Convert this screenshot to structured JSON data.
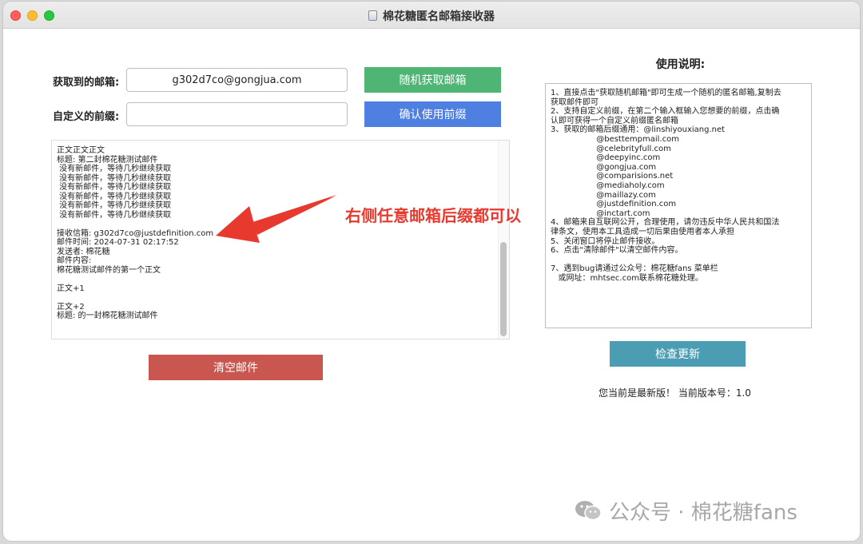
{
  "window": {
    "title": "棉花糖匿名邮箱接收器"
  },
  "email_row": {
    "label": "获取到的邮箱:",
    "value": "g302d7co@gongjua.com",
    "button": "随机获取邮箱"
  },
  "prefix_row": {
    "label": "自定义的前缀:",
    "value": "",
    "button": "确认使用前缀"
  },
  "log": {
    "lines": [
      "正文正文正文",
      "标题: 第二封棉花糖测试邮件",
      " 没有新邮件，等待几秒继续获取",
      " 没有新邮件，等待几秒继续获取",
      " 没有新邮件，等待几秒继续获取",
      " 没有新邮件，等待几秒继续获取",
      " 没有新邮件，等待几秒继续获取",
      " 没有新邮件，等待几秒继续获取",
      "",
      "接收信箱: g302d7co@justdefinition.com",
      "邮件时间: 2024-07-31 02:17:52",
      "发送者: 棉花糖",
      "邮件内容:",
      "棉花糖测试邮件的第一个正文",
      "",
      "正文+1",
      "",
      "正文+2",
      "标题: 的一封棉花糖测试邮件"
    ]
  },
  "annotation": "右侧任意邮箱后缀都可以",
  "clear_button": "清空邮件",
  "help": {
    "title": "使用说明:",
    "lines": [
      "1、直接点击\"获取随机邮箱\"即可生成一个随机的匿名邮箱,复制去",
      "获取邮件即可",
      "2、支持自定义前缀，在第二个输入框输入您想要的前缀，点击确",
      "认即可获得一个自定义前缀匿名邮箱",
      "3、获取的邮箱后缀通用：@linshiyouxiang.net",
      "                  @besttempmail.com",
      "                  @celebrityfull.com",
      "                  @deepyinc.com",
      "                  @gongjua.com",
      "                  @comparisions.net",
      "                  @mediaholy.com",
      "                  @maillazy.com",
      "                  @justdefinition.com",
      "                  @inctart.com",
      "4、邮箱来自互联网公开，合理使用，请勿违反中华人民共和国法",
      "律条文，使用本工具造成一切后果由使用者本人承担",
      "5、关闭窗口将停止邮件接收。",
      "6、点击\"清除邮件\"以清空邮件内容。",
      "",
      "7、遇到bug请通过公众号：棉花糖fans 菜单栏",
      "   或网址：mhtsec.com联系棉花糖处理。"
    ]
  },
  "update_button": "检查更新",
  "version_text": "您当前是最新版！  当前版本号：1.0",
  "watermark": "公众号 · 棉花糖fans",
  "colors": {
    "green_button": "#4fb574",
    "blue_button": "#4f7fe0",
    "red_button": "#c9574f",
    "teal_button": "#4a9db3",
    "annotation": "#e8392f"
  }
}
